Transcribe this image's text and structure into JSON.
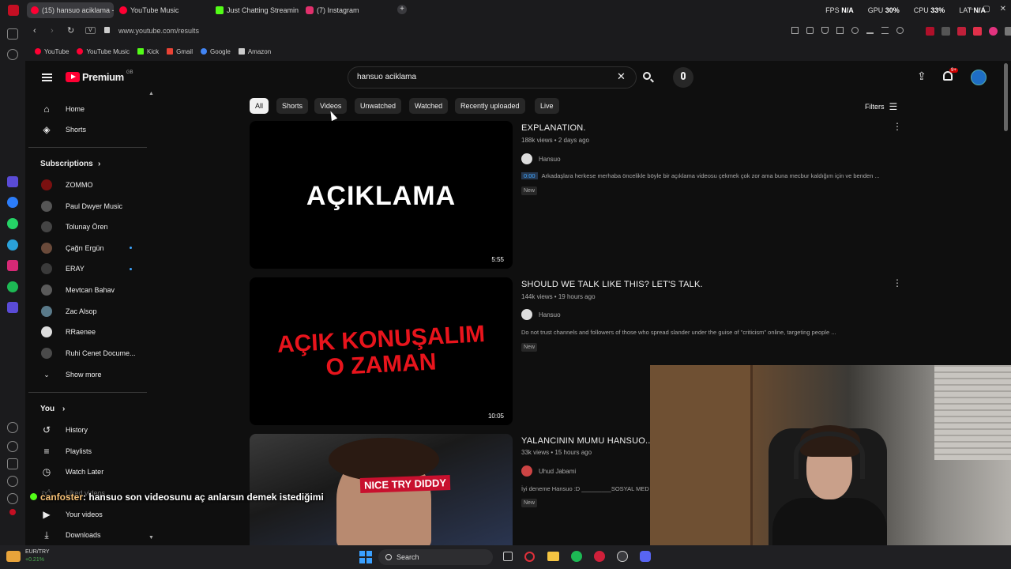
{
  "tabs": [
    {
      "label": "(15) hansuo aciklama - Yo",
      "color": "#ff0033",
      "active": true
    },
    {
      "label": "YouTube Music",
      "color": "#ff0033",
      "active": false
    },
    {
      "label": "Just Chatting Streaming -",
      "color": "#53fc18",
      "active": false
    },
    {
      "label": "(7) Instagram",
      "color": "#e1306c",
      "active": false
    }
  ],
  "new_tab_icon": "plus-icon",
  "perf": {
    "fps_label": "FPS",
    "fps_value": "N/A",
    "gpu_label": "GPU",
    "gpu_value": "30%",
    "cpu_label": "CPU",
    "cpu_value": "33%",
    "lat_label": "LAT",
    "lat_value": "N/A"
  },
  "address": {
    "url": "www.youtube.com/results",
    "badge": "V"
  },
  "bookmarks": [
    {
      "label": "YouTube",
      "color": "#ff0033"
    },
    {
      "label": "YouTube Music",
      "color": "#ff0033"
    },
    {
      "label": "Kick",
      "color": "#53fc18"
    },
    {
      "label": "Gmail",
      "color": "#ea4335"
    },
    {
      "label": "Google",
      "color": "#4285f4"
    },
    {
      "label": "Amazon",
      "color": "#cccccc"
    }
  ],
  "header": {
    "logo_text": "Premium",
    "logo_sup": "GB",
    "search_value": "hansuo aciklama",
    "notification_count": "9+"
  },
  "nav": {
    "home": "Home",
    "shorts": "Shorts",
    "subscriptions_heading": "Subscriptions",
    "subscriptions": [
      {
        "name": "ZOMMO",
        "dot": false,
        "color": "#7a1010"
      },
      {
        "name": "Paul Dwyer Music",
        "dot": false,
        "color": "#555555"
      },
      {
        "name": "Tolunay Ören",
        "dot": false,
        "color": "#444444"
      },
      {
        "name": "Çağrı Ergün",
        "dot": true,
        "color": "#6a4a3a"
      },
      {
        "name": "ERAY",
        "dot": true,
        "color": "#3a3a3a"
      },
      {
        "name": "Mevtcan Bahav",
        "dot": false,
        "color": "#5a5a5a"
      },
      {
        "name": "Zac Alsop",
        "dot": false,
        "color": "#5a7a8a"
      },
      {
        "name": "RRaenee",
        "dot": false,
        "color": "#dddddd"
      },
      {
        "name": "Ruhi Cenet Docume...",
        "dot": false,
        "color": "#4a4a4a"
      }
    ],
    "show_more": "Show more",
    "you_heading": "You",
    "history": "History",
    "playlists": "Playlists",
    "watch_later": "Watch Later",
    "liked_videos": "Liked videos",
    "your_videos": "Your videos",
    "downloads": "Downloads"
  },
  "chips": [
    "All",
    "Shorts",
    "Videos",
    "Unwatched",
    "Watched",
    "Recently uploaded",
    "Live"
  ],
  "filters_label": "Filters",
  "videos": [
    {
      "thumb_text": "AÇIKLAMA",
      "thumb_text2": "",
      "thumb_color": "#ffffff",
      "duration": "5:55",
      "title": "EXPLANATION.",
      "meta": "188k views • 2 days ago",
      "channel": "Hansuo",
      "timestamp": "0:00",
      "description": "Arkadaşlara herkese merhaba öncelikle böyle bir açıklama videosu çekmek çok zor ama buna mecbur kaldığım için ve benden ...",
      "badge": "New"
    },
    {
      "thumb_text": "AÇIK KONUŞALIM",
      "thumb_text2": "O ZAMAN",
      "thumb_color": "#e8141c",
      "duration": "10:05",
      "title": "SHOULD WE TALK LIKE THIS? LET'S TALK.",
      "meta": "144k views • 19 hours ago",
      "channel": "Hansuo",
      "timestamp": "",
      "description": "Do not trust channels and followers of those who spread slander under the guise of \"criticism\" online, targeting people ...",
      "badge": "New"
    },
    {
      "thumb_text": "NICE TRY DIDDY",
      "thumb_text2": "",
      "thumb_color": "#ffffff",
      "duration": "",
      "title": "YALANCININ MUMU HANSUO...",
      "meta": "33k views • 15 hours ago",
      "channel": "Uhud Jabami",
      "timestamp": "",
      "description": "İyi deneme Hansuo :D _________SOSYAL MED",
      "badge": "New"
    }
  ],
  "chat": {
    "user": "canfoster",
    "message": "hansuo son videosunu aç anlarsın demek istediğimi"
  },
  "taskbar": {
    "ticker_name": "EUR/TRY",
    "ticker_change": "+0.21%",
    "search": "Search"
  }
}
